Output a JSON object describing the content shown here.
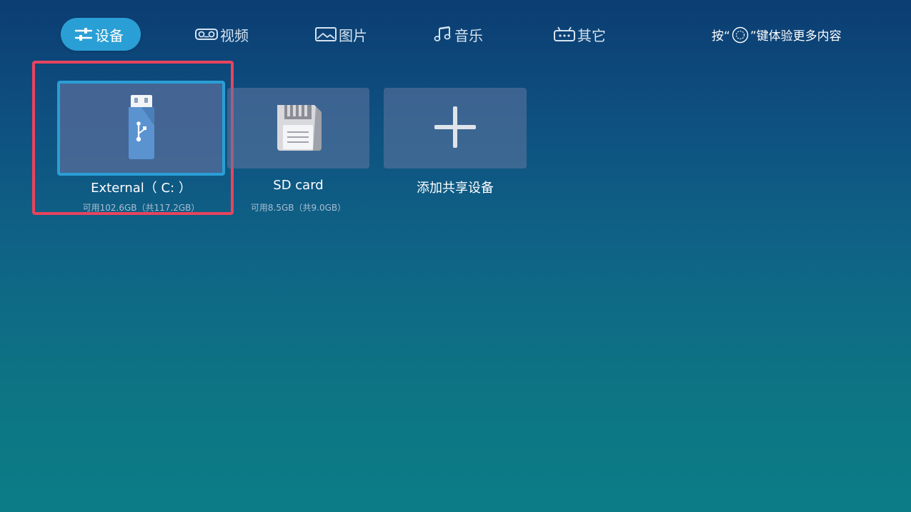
{
  "nav": {
    "tabs": [
      {
        "label": "设备",
        "icon": "sliders-icon",
        "active": true
      },
      {
        "label": "视频",
        "icon": "video-reel-icon",
        "active": false
      },
      {
        "label": "图片",
        "icon": "picture-icon",
        "active": false
      },
      {
        "label": "音乐",
        "icon": "music-note-icon",
        "active": false
      },
      {
        "label": "其它",
        "icon": "other-box-icon",
        "active": false
      }
    ],
    "hint": {
      "prefix": "按“",
      "icon": "menu-key-icon",
      "suffix": "”键体验更多内容"
    }
  },
  "devices": [
    {
      "title": "External（ C: ）",
      "subtitle": "可用102.6GB（共117.2GB）",
      "icon": "usb-drive-icon",
      "focused": true
    },
    {
      "title": "SD card",
      "subtitle": "可用8.5GB（共9.0GB）",
      "icon": "sd-card-icon",
      "focused": false
    },
    {
      "title": "添加共享设备",
      "subtitle": "",
      "icon": "plus-icon",
      "focused": false
    }
  ],
  "colors": {
    "accent": "#2a9fd6",
    "selection": "#e8445e",
    "background_top": "#0c3d72",
    "background_bottom": "#0c7d86"
  }
}
